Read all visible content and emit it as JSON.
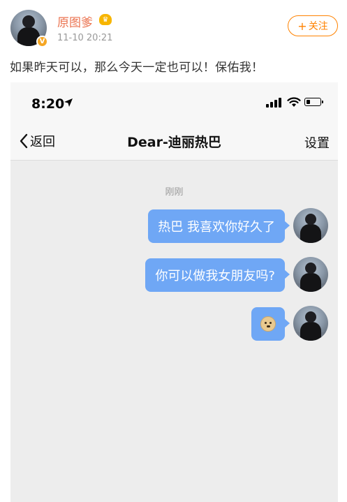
{
  "post": {
    "username": "原图爹",
    "timestamp": "11-10 20:21",
    "follow_label": "关注",
    "text": "如果昨天可以，那么今天一定也可以！保佑我！"
  },
  "status_bar": {
    "time": "8:20"
  },
  "chat": {
    "back_label": "返回",
    "title": "Dear-迪丽热巴",
    "settings_label": "设置",
    "time_separator": "刚刚",
    "messages": [
      {
        "text": "热巴 我喜欢你好久了",
        "type": "text"
      },
      {
        "text": "你可以做我女朋友吗?",
        "type": "text"
      },
      {
        "text": "",
        "type": "emoji",
        "emoji": "doge-icon"
      }
    ]
  },
  "colors": {
    "username": "#eb7350",
    "follow": "#ff8200",
    "bubble": "#6fa7f5",
    "chat_bg": "#ededed"
  }
}
